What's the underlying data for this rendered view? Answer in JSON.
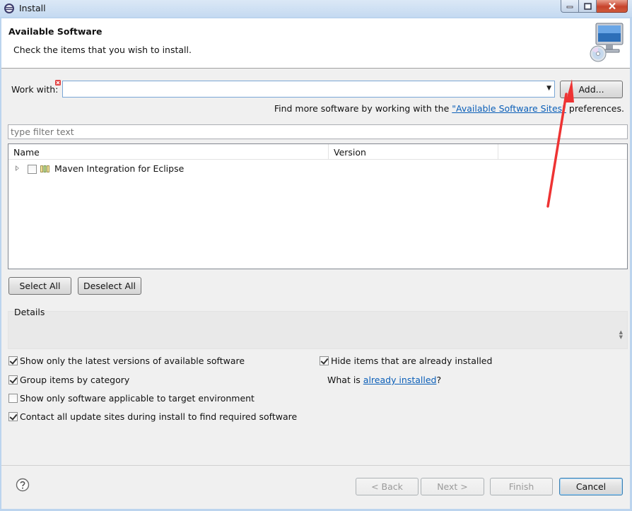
{
  "window": {
    "title": "Install"
  },
  "header": {
    "title": "Available Software",
    "description": "Check the items that you wish to install."
  },
  "work_with": {
    "label": "Work with:",
    "value": "",
    "add_button": "Add..."
  },
  "find_more": {
    "prefix": "Find more software by working with the ",
    "link": "\"Available Software Sites\"",
    "suffix": " preferences."
  },
  "filter": {
    "placeholder": "type filter text"
  },
  "table": {
    "columns": [
      "Name",
      "Version"
    ],
    "rows": [
      {
        "name": "Maven Integration for Eclipse",
        "version": "",
        "checked": false,
        "expandable": true
      }
    ]
  },
  "selection_buttons": {
    "select_all": "Select All",
    "deselect_all": "Deselect All"
  },
  "details": {
    "label": "Details"
  },
  "options": {
    "latest_versions": {
      "label": "Show only the latest versions of available software",
      "checked": true
    },
    "group_by_category": {
      "label": "Group items by category",
      "checked": true
    },
    "applicable_only": {
      "label": "Show only software applicable to target environment",
      "checked": false
    },
    "contact_all_sites": {
      "label": "Contact all update sites during install to find required software",
      "checked": true
    },
    "hide_installed": {
      "label": "Hide items that are already installed",
      "checked": true
    },
    "what_is_prefix": "What is ",
    "already_installed_link": "already installed",
    "what_is_suffix": "?"
  },
  "footer": {
    "back": "< Back",
    "next": "Next >",
    "finish": "Finish",
    "cancel": "Cancel"
  },
  "icons": {
    "app": "eclipse-icon",
    "banner": "monitor-cd-icon",
    "error": "error-decoration-icon",
    "category": "category-icon",
    "help": "help-icon",
    "annotation": "red-arrow-annotation"
  },
  "colors": {
    "link": "#0b5fb8",
    "annotation_arrow": "#ee3333"
  }
}
